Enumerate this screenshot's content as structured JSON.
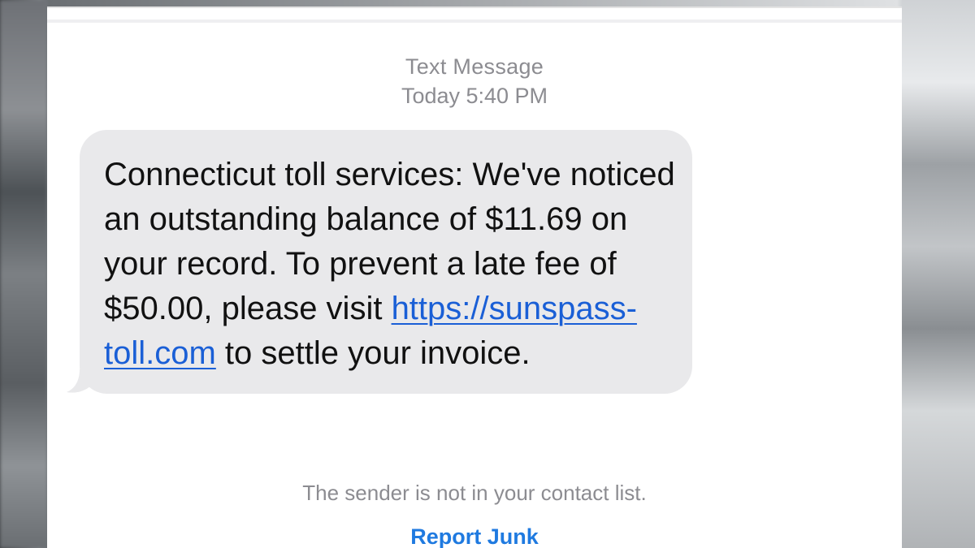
{
  "header": {
    "service": "Text Message",
    "timestamp": "Today 5:40 PM"
  },
  "message": {
    "text_before_link": "Connecticut toll services: We've noticed an outstanding balance of $11.69 on your record. To prevent a late fee of $50.00, please visit ",
    "link": "https://sunspass-toll.com",
    "text_after_link": " to settle your invoice."
  },
  "footer": {
    "notice": "The sender is not in your contact list.",
    "report_label": "Report Junk"
  },
  "colors": {
    "bubble": "#e9e9eb",
    "link": "#1a5fd6",
    "action": "#1f7ae0",
    "meta_text": "#8c8c91"
  }
}
